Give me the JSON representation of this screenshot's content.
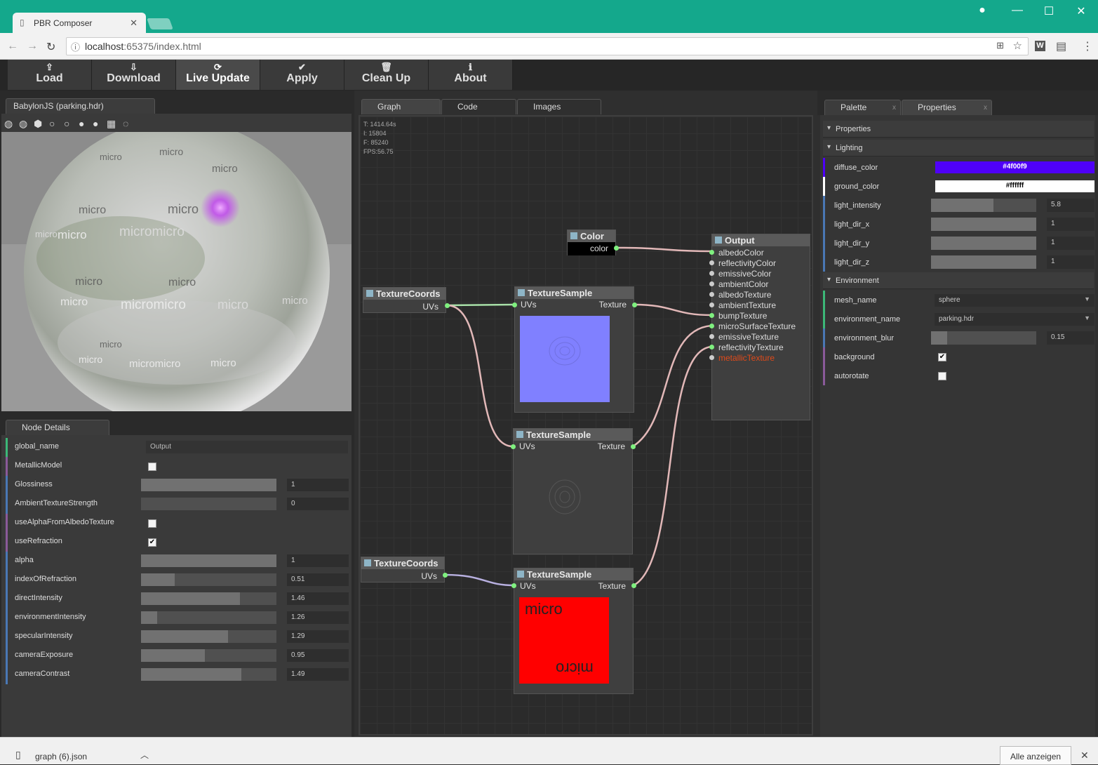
{
  "browser": {
    "tab_title": "PBR Composer",
    "tab_close": "✕",
    "url_host": "localhost",
    "url_rest": ":65375/index.html",
    "show_all": "Alle anzeigen",
    "download_item": "graph (6).json"
  },
  "toolbar": {
    "load": "Load",
    "download": "Download",
    "live_update": "Live Update",
    "apply": "Apply",
    "clean_up": "Clean Up",
    "about": "About"
  },
  "viewer": {
    "tab": "BabylonJS (parking.hdr)",
    "sphere_texts": [
      "micro",
      "micro",
      "micro",
      "micro",
      "micro",
      "micromicro",
      "micro",
      "micro",
      "micromicro",
      "micro",
      "micro",
      "micro",
      "micro",
      "micro",
      "micro",
      "micro",
      "micromicro",
      "micro"
    ]
  },
  "details": {
    "tab": "Node Details",
    "global_name_label": "global_name",
    "global_name_value": "Output",
    "rows": [
      {
        "label": "MetallicModel",
        "type": "checkbox",
        "checked": false
      },
      {
        "label": "Glossiness",
        "type": "slider",
        "value": "1",
        "fill": 1.0
      },
      {
        "label": "AmbientTextureStrength",
        "type": "slider",
        "value": "0",
        "fill": 0.0
      },
      {
        "label": "useAlphaFromAlbedoTexture",
        "type": "checkbox",
        "checked": false
      },
      {
        "label": "useRefraction",
        "type": "checkbox",
        "checked": true
      },
      {
        "label": "alpha",
        "type": "slider",
        "value": "1",
        "fill": 1.0
      },
      {
        "label": "indexOfRefraction",
        "type": "slider",
        "value": "0.51",
        "fill": 0.25
      },
      {
        "label": "directIntensity",
        "type": "slider",
        "value": "1.46",
        "fill": 0.73
      },
      {
        "label": "environmentIntensity",
        "type": "slider",
        "value": "1.26",
        "fill": 0.12
      },
      {
        "label": "specularIntensity",
        "type": "slider",
        "value": "1.29",
        "fill": 0.64
      },
      {
        "label": "cameraExposure",
        "type": "slider",
        "value": "0.95",
        "fill": 0.47
      },
      {
        "label": "cameraContrast",
        "type": "slider",
        "value": "1.49",
        "fill": 0.74
      }
    ]
  },
  "graph": {
    "tabs": [
      "Graph",
      "Code",
      "Images"
    ],
    "stats": [
      "T: 1414.64s",
      "I: 15804",
      "F: 85240",
      "FPS:56.75"
    ],
    "nodes": {
      "color_title": "Color",
      "color_port": "color",
      "output_title": "Output",
      "output_ports": [
        "albedoColor",
        "reflectivityColor",
        "emissiveColor",
        "ambientColor",
        "albedoTexture",
        "ambientTexture",
        "bumpTexture",
        "microSurfaceTexture",
        "emissiveTexture",
        "reflectivityTexture",
        "metallicTexture"
      ],
      "texcoords_title": "TextureCoords",
      "uvs": "UVs",
      "texsample_title": "TextureSample",
      "texture": "Texture",
      "micro_text": "micro"
    }
  },
  "right": {
    "tabs": [
      "Palette",
      "Properties"
    ],
    "tab_close": "x",
    "sections": {
      "properties": "Properties",
      "lighting": "Lighting",
      "environment": "Environment"
    },
    "lighting": {
      "diffuse_label": "diffuse_color",
      "diffuse_value": "#4f00f9",
      "ground_label": "ground_color",
      "ground_value": "#ffffff",
      "light_intensity_label": "light_intensity",
      "light_intensity_value": "5.8",
      "light_intensity_fill": 0.59,
      "light_dir_x_label": "light_dir_x",
      "light_dir_x_value": "1",
      "light_dir_y_label": "light_dir_y",
      "light_dir_y_value": "1",
      "light_dir_z_label": "light_dir_z",
      "light_dir_z_value": "1"
    },
    "environment": {
      "mesh_name_label": "mesh_name",
      "mesh_name_value": "sphere",
      "environment_name_label": "environment_name",
      "environment_name_value": "parking.hdr",
      "environment_blur_label": "environment_blur",
      "environment_blur_value": "0.15",
      "environment_blur_fill": 0.15,
      "background_label": "background",
      "background_checked": true,
      "autorotate_label": "autorotate",
      "autorotate_checked": false
    }
  },
  "colors": {
    "titlebar": "#14a88c",
    "diffuse": "#4f00f9",
    "texture_blue": "#8080ff",
    "texture_red": "#ff0000",
    "metallic_red": "#e04a1a"
  }
}
